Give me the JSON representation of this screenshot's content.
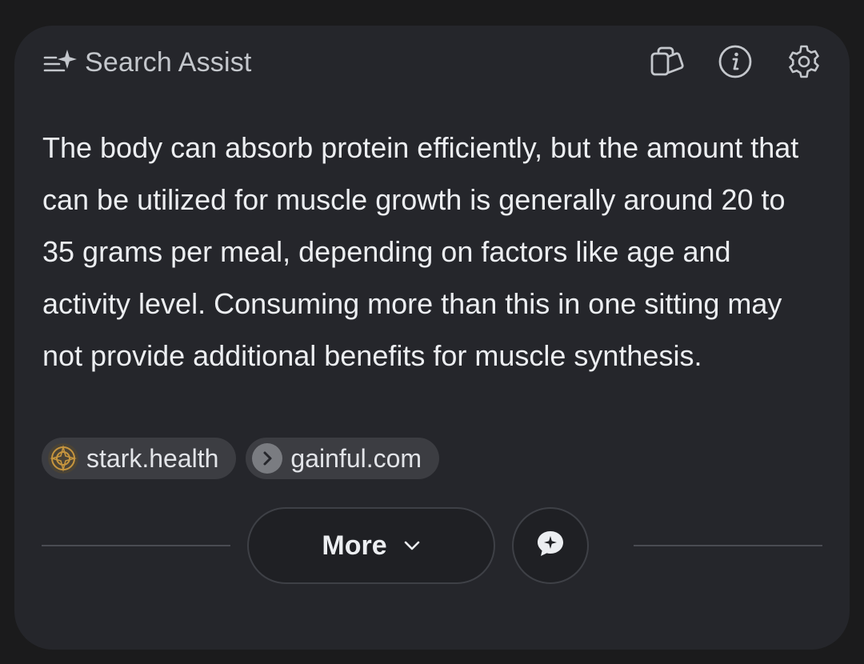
{
  "header": {
    "title": "Search Assist",
    "title_icon": "sparkle-list-icon",
    "actions": [
      {
        "icon": "copy-icon"
      },
      {
        "icon": "info-icon"
      },
      {
        "icon": "gear-icon"
      }
    ]
  },
  "answer": {
    "text": "The body can absorb protein efficiently, but the amount that can be utilized for muscle growth is generally around 20 to 35 grams per meal, depending on factors like age and activity level. Consuming more than this in one sitting may not provide additional benefits for muscle synthesis."
  },
  "sources": [
    {
      "label": "stark.health",
      "icon": "stark-health-logo-icon"
    },
    {
      "label": "gainful.com",
      "icon": "chevron-right-icon"
    }
  ],
  "footer": {
    "more_label": "More",
    "more_icon": "chevron-down-icon",
    "chat_icon": "chat-sparkle-icon"
  },
  "colors": {
    "background": "#1b1b1c",
    "card": "#25262b",
    "chip": "#3c3d42",
    "text": "#eceef1",
    "muted": "#c4c7cc",
    "accent_stark": "#c6953e"
  }
}
